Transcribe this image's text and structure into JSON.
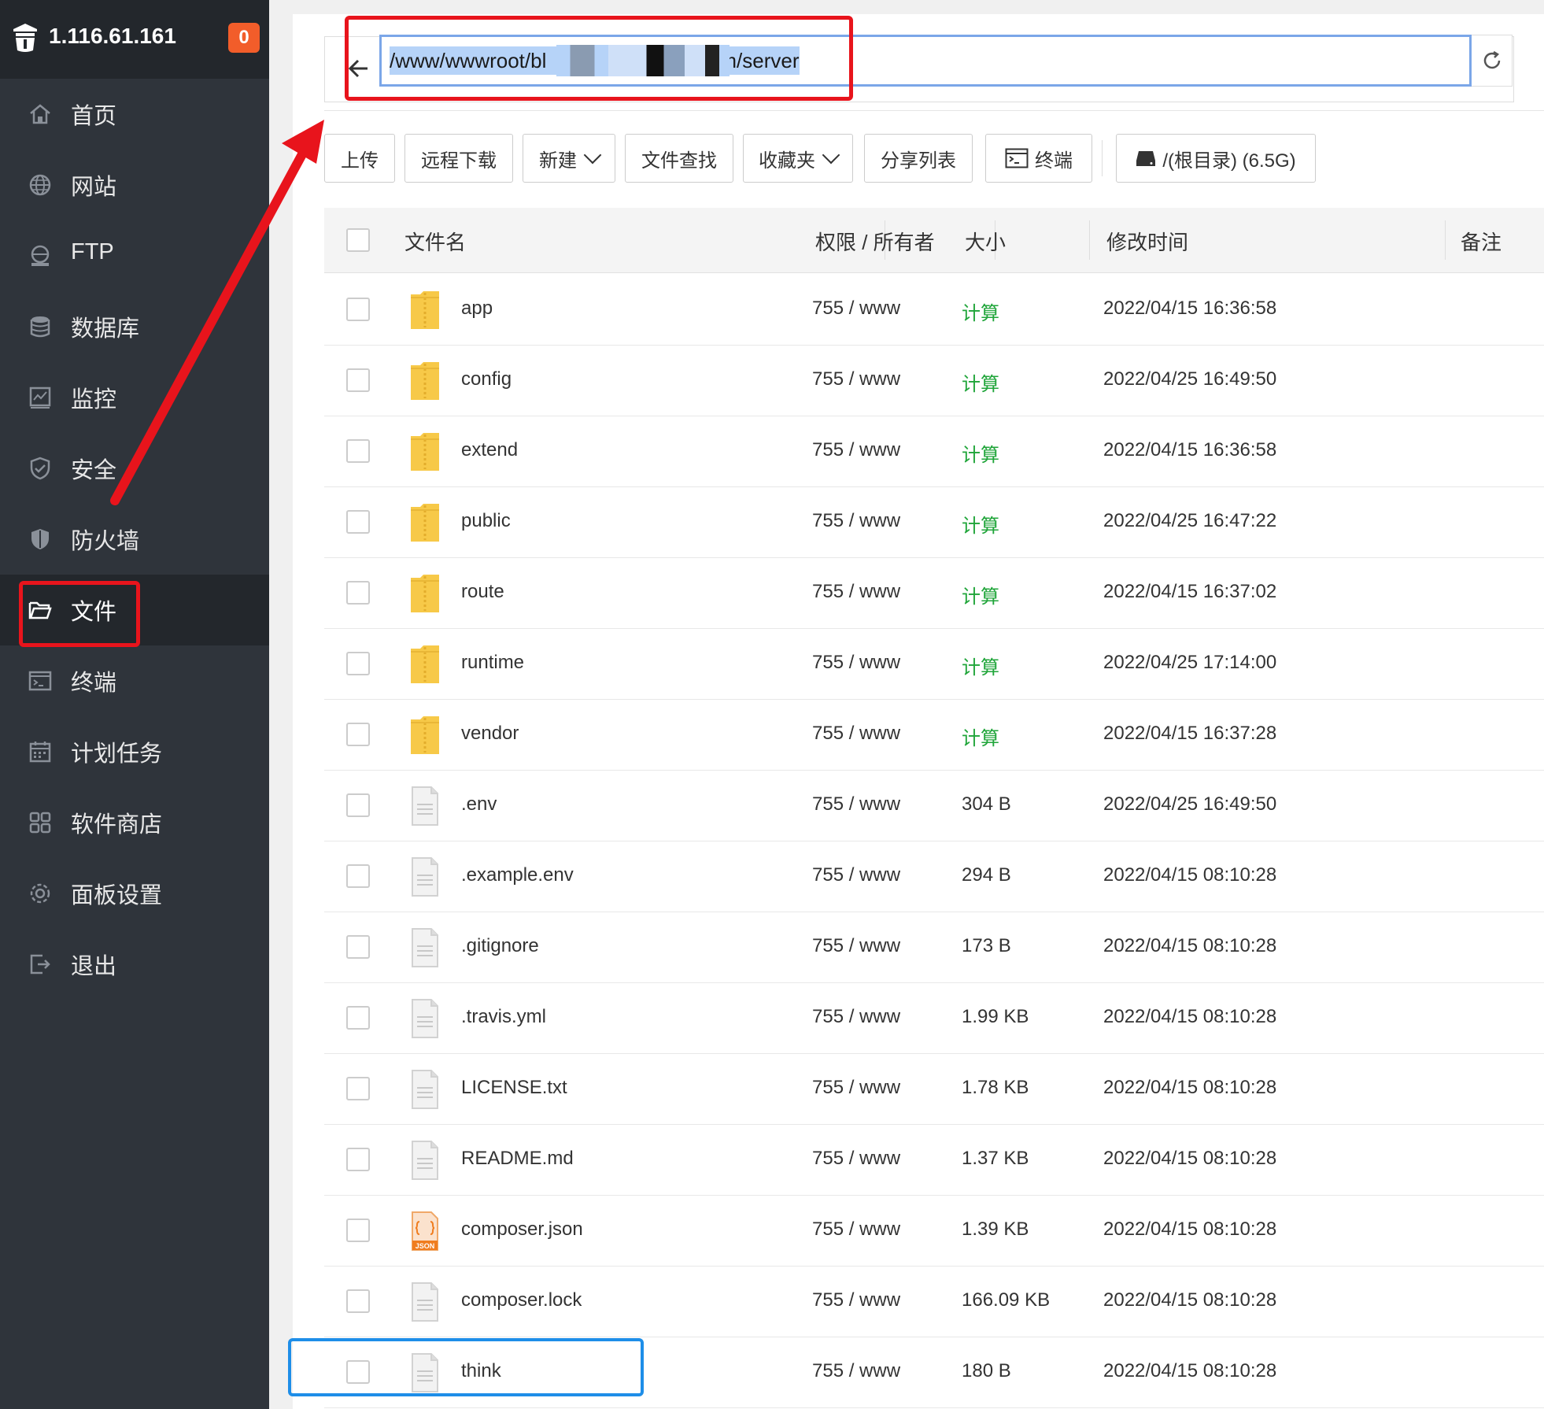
{
  "sidebar": {
    "ip": "1.116.61.161",
    "badge": "0",
    "items": [
      {
        "label": "首页",
        "icon": "home-icon"
      },
      {
        "label": "网站",
        "icon": "globe-icon"
      },
      {
        "label": "FTP",
        "icon": "ftp-icon"
      },
      {
        "label": "数据库",
        "icon": "database-icon"
      },
      {
        "label": "监控",
        "icon": "monitor-icon"
      },
      {
        "label": "安全",
        "icon": "shield-check-icon"
      },
      {
        "label": "防火墙",
        "icon": "firewall-icon"
      },
      {
        "label": "文件",
        "icon": "folder-open-icon",
        "active": true
      },
      {
        "label": "终端",
        "icon": "terminal-icon"
      },
      {
        "label": "计划任务",
        "icon": "calendar-icon"
      },
      {
        "label": "软件商店",
        "icon": "apps-icon"
      },
      {
        "label": "面板设置",
        "icon": "gear-icon"
      },
      {
        "label": "退出",
        "icon": "logout-icon"
      }
    ]
  },
  "path_bar": {
    "path_prefix": "/www/wwwroot/bl",
    "path_suffix": "m/server"
  },
  "toolbar": {
    "upload": "上传",
    "remote_download": "远程下载",
    "new": "新建",
    "file_search": "文件查找",
    "favorites": "收藏夹",
    "share_list": "分享列表",
    "terminal": "终端",
    "disk": "/(根目录) (6.5G)"
  },
  "table": {
    "headers": {
      "name": "文件名",
      "perm": "权限 / 所有者",
      "size": "大小",
      "mtime": "修改时间",
      "note": "备注"
    },
    "rows": [
      {
        "name": "app",
        "type": "folder",
        "perm": "755 / www",
        "size": "计算",
        "mtime": "2022/04/15 16:36:58"
      },
      {
        "name": "config",
        "type": "folder",
        "perm": "755 / www",
        "size": "计算",
        "mtime": "2022/04/25 16:49:50"
      },
      {
        "name": "extend",
        "type": "folder",
        "perm": "755 / www",
        "size": "计算",
        "mtime": "2022/04/15 16:36:58"
      },
      {
        "name": "public",
        "type": "folder",
        "perm": "755 / www",
        "size": "计算",
        "mtime": "2022/04/25 16:47:22"
      },
      {
        "name": "route",
        "type": "folder",
        "perm": "755 / www",
        "size": "计算",
        "mtime": "2022/04/15 16:37:02"
      },
      {
        "name": "runtime",
        "type": "folder",
        "perm": "755 / www",
        "size": "计算",
        "mtime": "2022/04/25 17:14:00"
      },
      {
        "name": "vendor",
        "type": "folder",
        "perm": "755 / www",
        "size": "计算",
        "mtime": "2022/04/15 16:37:28"
      },
      {
        "name": ".env",
        "type": "file",
        "perm": "755 / www",
        "size": "304 B",
        "mtime": "2022/04/25 16:49:50"
      },
      {
        "name": ".example.env",
        "type": "file",
        "perm": "755 / www",
        "size": "294 B",
        "mtime": "2022/04/15 08:10:28"
      },
      {
        "name": ".gitignore",
        "type": "file",
        "perm": "755 / www",
        "size": "173 B",
        "mtime": "2022/04/15 08:10:28"
      },
      {
        "name": ".travis.yml",
        "type": "file",
        "perm": "755 / www",
        "size": "1.99 KB",
        "mtime": "2022/04/15 08:10:28"
      },
      {
        "name": "LICENSE.txt",
        "type": "file",
        "perm": "755 / www",
        "size": "1.78 KB",
        "mtime": "2022/04/15 08:10:28"
      },
      {
        "name": "README.md",
        "type": "file",
        "perm": "755 / www",
        "size": "1.37 KB",
        "mtime": "2022/04/15 08:10:28"
      },
      {
        "name": "composer.json",
        "type": "json",
        "perm": "755 / www",
        "size": "1.39 KB",
        "mtime": "2022/04/15 08:10:28"
      },
      {
        "name": "composer.lock",
        "type": "file",
        "perm": "755 / www",
        "size": "166.09 KB",
        "mtime": "2022/04/15 08:10:28"
      },
      {
        "name": "think",
        "type": "file",
        "perm": "755 / www",
        "size": "180 B",
        "mtime": "2022/04/15 08:10:28"
      }
    ],
    "json_icon_label": "JSON"
  },
  "colors": {
    "sidebar_bg": "#2f343b",
    "sidebar_header_bg": "#23272c",
    "badge": "#f25d2a",
    "calc_green": "#20a53a",
    "annotation_red": "#e8141c",
    "annotation_blue": "#1e8ee8",
    "folder_yellow": "#f7c948"
  }
}
